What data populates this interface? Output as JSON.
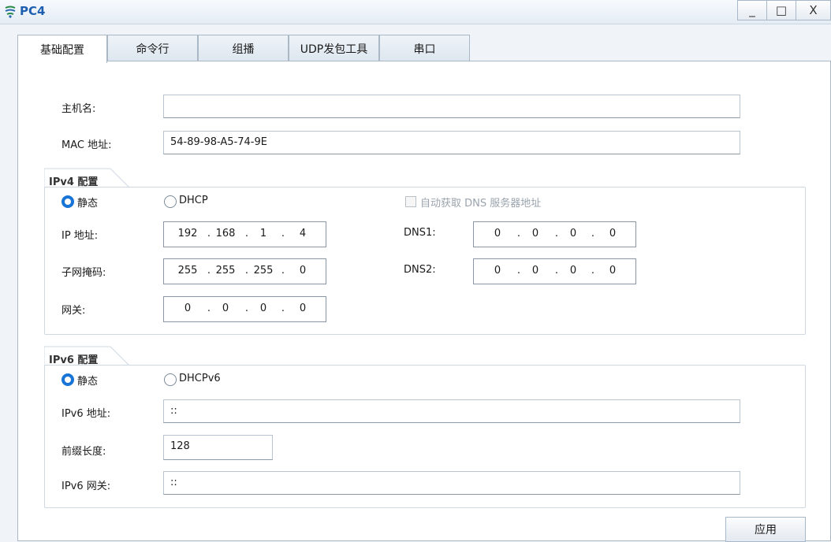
{
  "window": {
    "title": "PC4",
    "minimize": "_",
    "maximize": "□",
    "close": "X"
  },
  "tabs": [
    "基础配置",
    "命令行",
    "组播",
    "UDP发包工具",
    "串口"
  ],
  "basic": {
    "hostname_label": "主机名:",
    "hostname_value": "",
    "mac_label": "MAC 地址:",
    "mac_value": "54-89-98-A5-74-9E"
  },
  "ipv4": {
    "group_title": "IPv4 配置",
    "static_label": "静态",
    "dhcp_label": "DHCP",
    "auto_dns_label": "自动获取 DNS 服务器地址",
    "ip_label": "IP 地址:",
    "ip": [
      "192",
      "168",
      "1",
      "4"
    ],
    "mask_label": "子网掩码:",
    "mask": [
      "255",
      "255",
      "255",
      "0"
    ],
    "gateway_label": "网关:",
    "gateway": [
      "0",
      "0",
      "0",
      "0"
    ],
    "dns1_label": "DNS1:",
    "dns1": [
      "0",
      "0",
      "0",
      "0"
    ],
    "dns2_label": "DNS2:",
    "dns2": [
      "0",
      "0",
      "0",
      "0"
    ]
  },
  "ipv6": {
    "group_title": "IPv6 配置",
    "static_label": "静态",
    "dhcp_label": "DHCPv6",
    "addr_label": "IPv6 地址:",
    "addr_value": "::",
    "prefix_label": "前缀长度:",
    "prefix_value": "128",
    "gateway_label": "IPv6 网关:",
    "gateway_value": "::"
  },
  "apply_label": "应用",
  "colors": {
    "title": "#1f5fb0",
    "radio_selected": "#1874d6"
  }
}
